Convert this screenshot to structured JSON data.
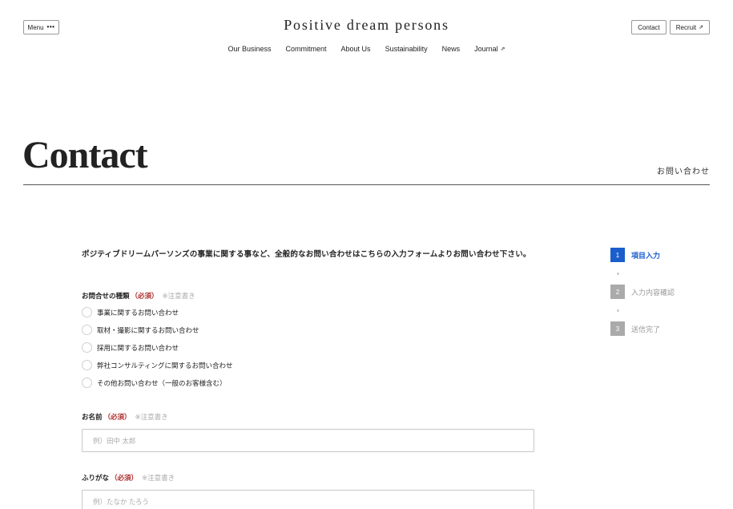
{
  "header": {
    "menu_label": "Menu",
    "menu_dots": "•••",
    "brand": "Positive dream persons",
    "contact_label": "Contact",
    "recruit_label": "Recruit",
    "nav": [
      {
        "label": "Our Business"
      },
      {
        "label": "Commitment"
      },
      {
        "label": "About Us"
      },
      {
        "label": "Sustainability"
      },
      {
        "label": "News"
      },
      {
        "label": "Journal"
      }
    ]
  },
  "page": {
    "title": "Contact",
    "subtitle": "お問い合わせ",
    "intro": "ポジティブドリームパーソンズの事業に関する事など、全般的なお問い合わせはこちらの入力フォームよりお問い合わせ下さい。"
  },
  "form": {
    "inquiry_type": {
      "label": "お問合せの種類",
      "required": "（必須）",
      "note": "※注意書き",
      "options": [
        "事業に関するお問い合わせ",
        "取材・撮影に関するお問い合わせ",
        "採用に関するお問い合わせ",
        "弊社コンサルティングに関するお問い合わせ",
        "その他お問い合わせ（一般のお客様含む）"
      ]
    },
    "name": {
      "label": "お名前",
      "required": "（必須）",
      "note": "※注意書き",
      "placeholder": "例）田中 太郎",
      "value": ""
    },
    "furigana": {
      "label": "ふりがな",
      "required": "（必須）",
      "note": "※注意書き",
      "placeholder": "例）たなか たろう",
      "value": ""
    }
  },
  "steps": [
    {
      "number": "1",
      "label": "項目入力",
      "active": true
    },
    {
      "number": "2",
      "label": "入力内容確認",
      "active": false
    },
    {
      "number": "3",
      "label": "送信完了",
      "active": false
    }
  ],
  "colors": {
    "accent": "#1a5ecc",
    "required": "#b03030",
    "inactive_step": "#aaaaaa"
  }
}
